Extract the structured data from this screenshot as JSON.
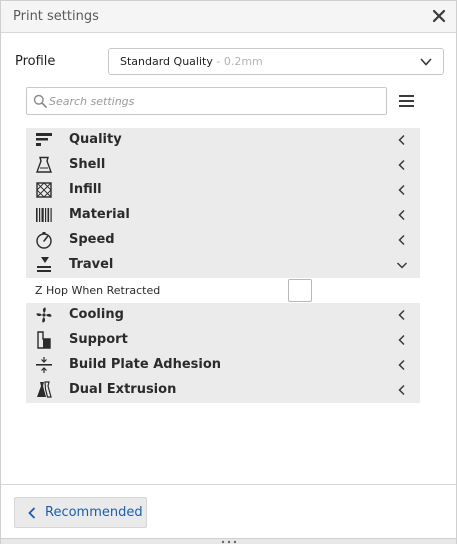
{
  "window": {
    "title": "Print settings",
    "close_icon": "close-icon"
  },
  "profile": {
    "label": "Profile",
    "value": "Standard Quality",
    "value_sub": " - 0.2mm",
    "icon": "chevron-down-icon"
  },
  "search": {
    "placeholder": "Search settings",
    "value": "",
    "icon": "search-icon"
  },
  "menu": {
    "icon": "hamburger-menu-icon"
  },
  "categories": [
    {
      "label": "Quality",
      "icon": "quality-icon",
      "expanded": false
    },
    {
      "label": "Shell",
      "icon": "shell-icon",
      "expanded": false
    },
    {
      "label": "Infill",
      "icon": "infill-icon",
      "expanded": false
    },
    {
      "label": "Material",
      "icon": "material-icon",
      "expanded": false
    },
    {
      "label": "Speed",
      "icon": "speed-icon",
      "expanded": false
    },
    {
      "label": "Travel",
      "icon": "travel-icon",
      "expanded": true
    },
    {
      "label": "Cooling",
      "icon": "cooling-icon",
      "expanded": false
    },
    {
      "label": "Support",
      "icon": "support-icon",
      "expanded": false
    },
    {
      "label": "Build Plate Adhesion",
      "icon": "build-plate-adhesion-icon",
      "expanded": false
    },
    {
      "label": "Dual Extrusion",
      "icon": "dual-extrusion-icon",
      "expanded": false
    }
  ],
  "travel_settings": [
    {
      "label": "Z Hop When Retracted",
      "checked": false
    }
  ],
  "footer": {
    "recommended_label": "Recommended",
    "icon": "chevron-left-icon"
  },
  "colors": {
    "accent": "#1f5ca8",
    "category_bg": "#ebebeb",
    "border": "#c8c8c8"
  }
}
